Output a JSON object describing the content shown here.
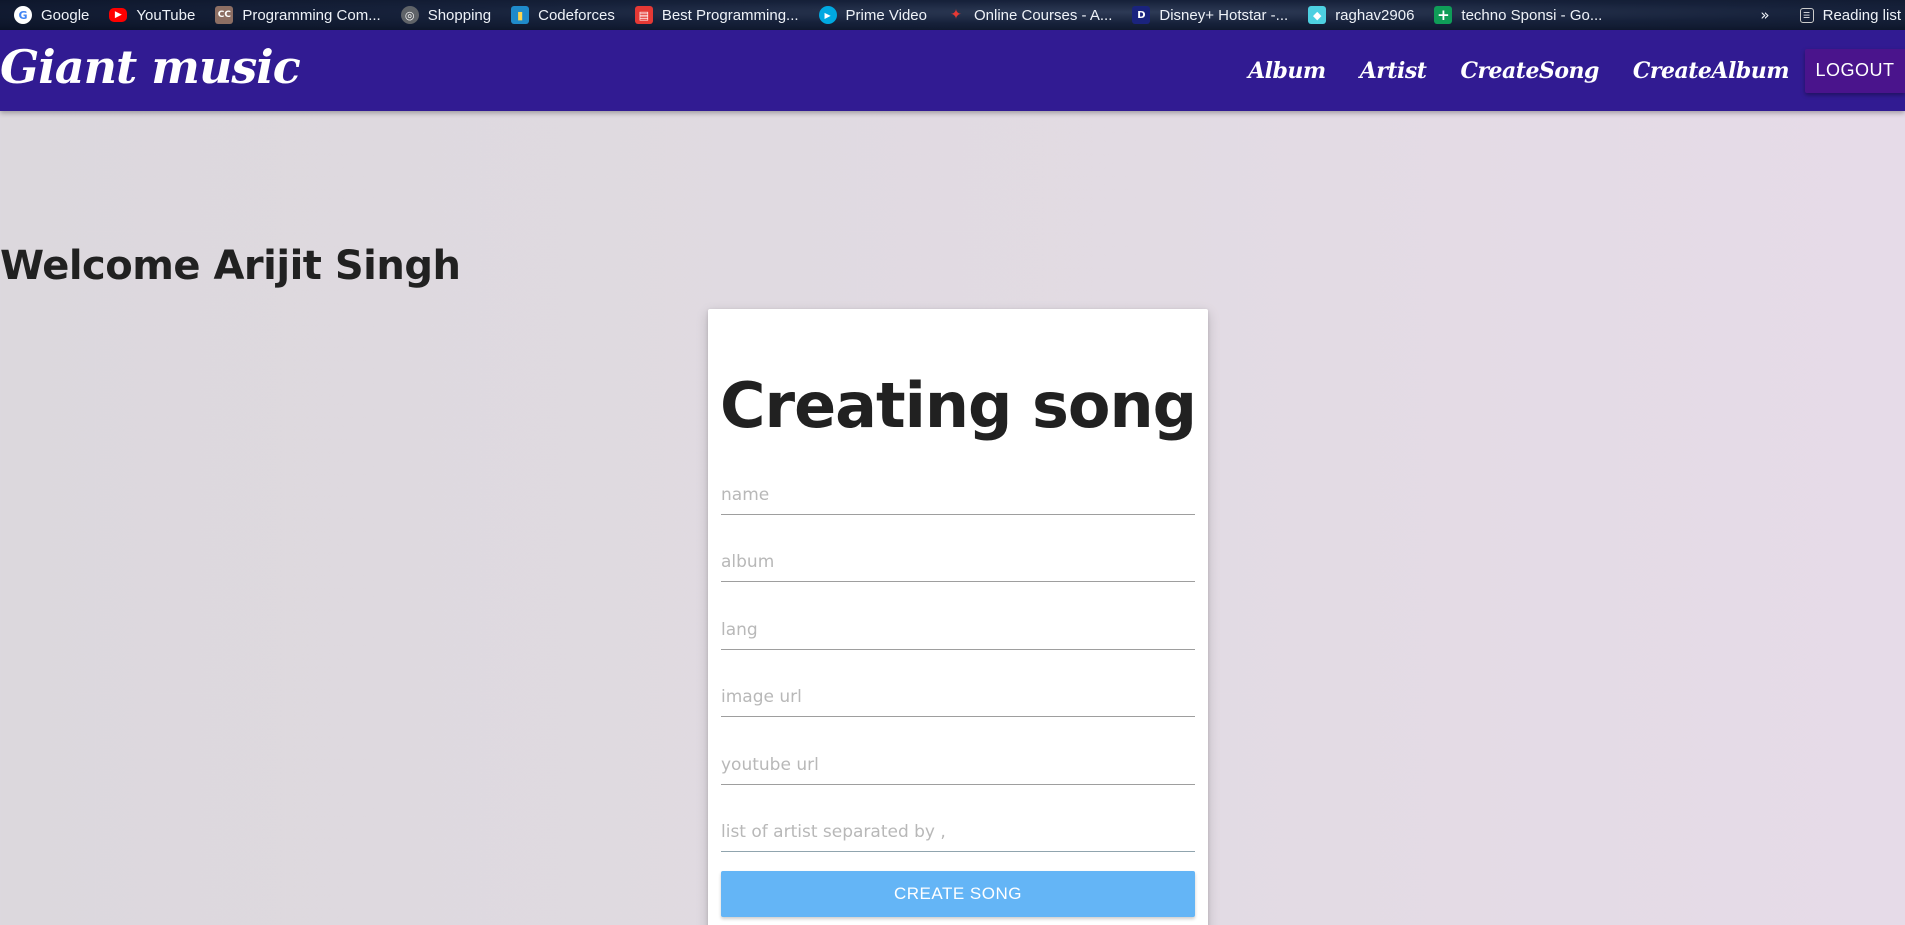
{
  "bookmarks": [
    {
      "label": "Google",
      "icon": "google-icon",
      "icon_text": "G",
      "color": "#ffffff",
      "text_color": "#4285f4"
    },
    {
      "label": "YouTube",
      "icon": "youtube-icon",
      "icon_text": "▶",
      "color": "#ff0000",
      "text_color": "#ffffff"
    },
    {
      "label": "Programming Com...",
      "icon": "codechef-icon",
      "icon_text": "CC",
      "color": "#8d6e63",
      "text_color": "#ffffff"
    },
    {
      "label": "Shopping",
      "icon": "globe-icon",
      "icon_text": "◎",
      "color": "#5f6368",
      "text_color": "#ffffff"
    },
    {
      "label": "Codeforces",
      "icon": "codeforces-icon",
      "icon_text": "▮",
      "color": "#1f8acb",
      "text_color": "#ffd54f"
    },
    {
      "label": "Best Programming...",
      "icon": "book-icon",
      "icon_text": "▤",
      "color": "#e53935",
      "text_color": "#ffffff"
    },
    {
      "label": "Prime Video",
      "icon": "prime-video-icon",
      "icon_text": "▶",
      "color": "#00a8e1",
      "text_color": "#ffffff"
    },
    {
      "label": "Online Courses - A...",
      "icon": "courses-icon",
      "icon_text": "✦",
      "color": "#e53935",
      "text_color": "#ffffff"
    },
    {
      "label": "Disney+ Hotstar -...",
      "icon": "hotstar-icon",
      "icon_text": "D",
      "color": "#1a237e",
      "text_color": "#ffffff"
    },
    {
      "label": "raghav2906",
      "icon": "anime-avatar-icon",
      "icon_text": "◆",
      "color": "#4dd0e1",
      "text_color": "#ffffff"
    },
    {
      "label": "techno Sponsi - Go...",
      "icon": "sheets-icon",
      "icon_text": "+",
      "color": "#0f9d58",
      "text_color": "#ffffff"
    }
  ],
  "bookmarks_more": "»",
  "reading_list": {
    "label": "Reading list",
    "icon": "reading-list-icon"
  },
  "navbar": {
    "brand": "Giant music",
    "links": [
      "Album",
      "Artist",
      "CreateSong",
      "CreateAlbum"
    ],
    "logout_label": "LOGOUT"
  },
  "welcome": "Welcome Arijit Singh",
  "form": {
    "title": "Creating song",
    "fields": [
      {
        "placeholder": "name",
        "value": ""
      },
      {
        "placeholder": "album",
        "value": ""
      },
      {
        "placeholder": "lang",
        "value": ""
      },
      {
        "placeholder": "image url",
        "value": ""
      },
      {
        "placeholder": "youtube url",
        "value": ""
      },
      {
        "placeholder": "list of artist separated by ,",
        "value": ""
      }
    ],
    "submit_label": "CREATE SONG"
  },
  "colors": {
    "navbar": "#311b92",
    "logout": "#4a148c",
    "submit": "#64b5f6"
  }
}
